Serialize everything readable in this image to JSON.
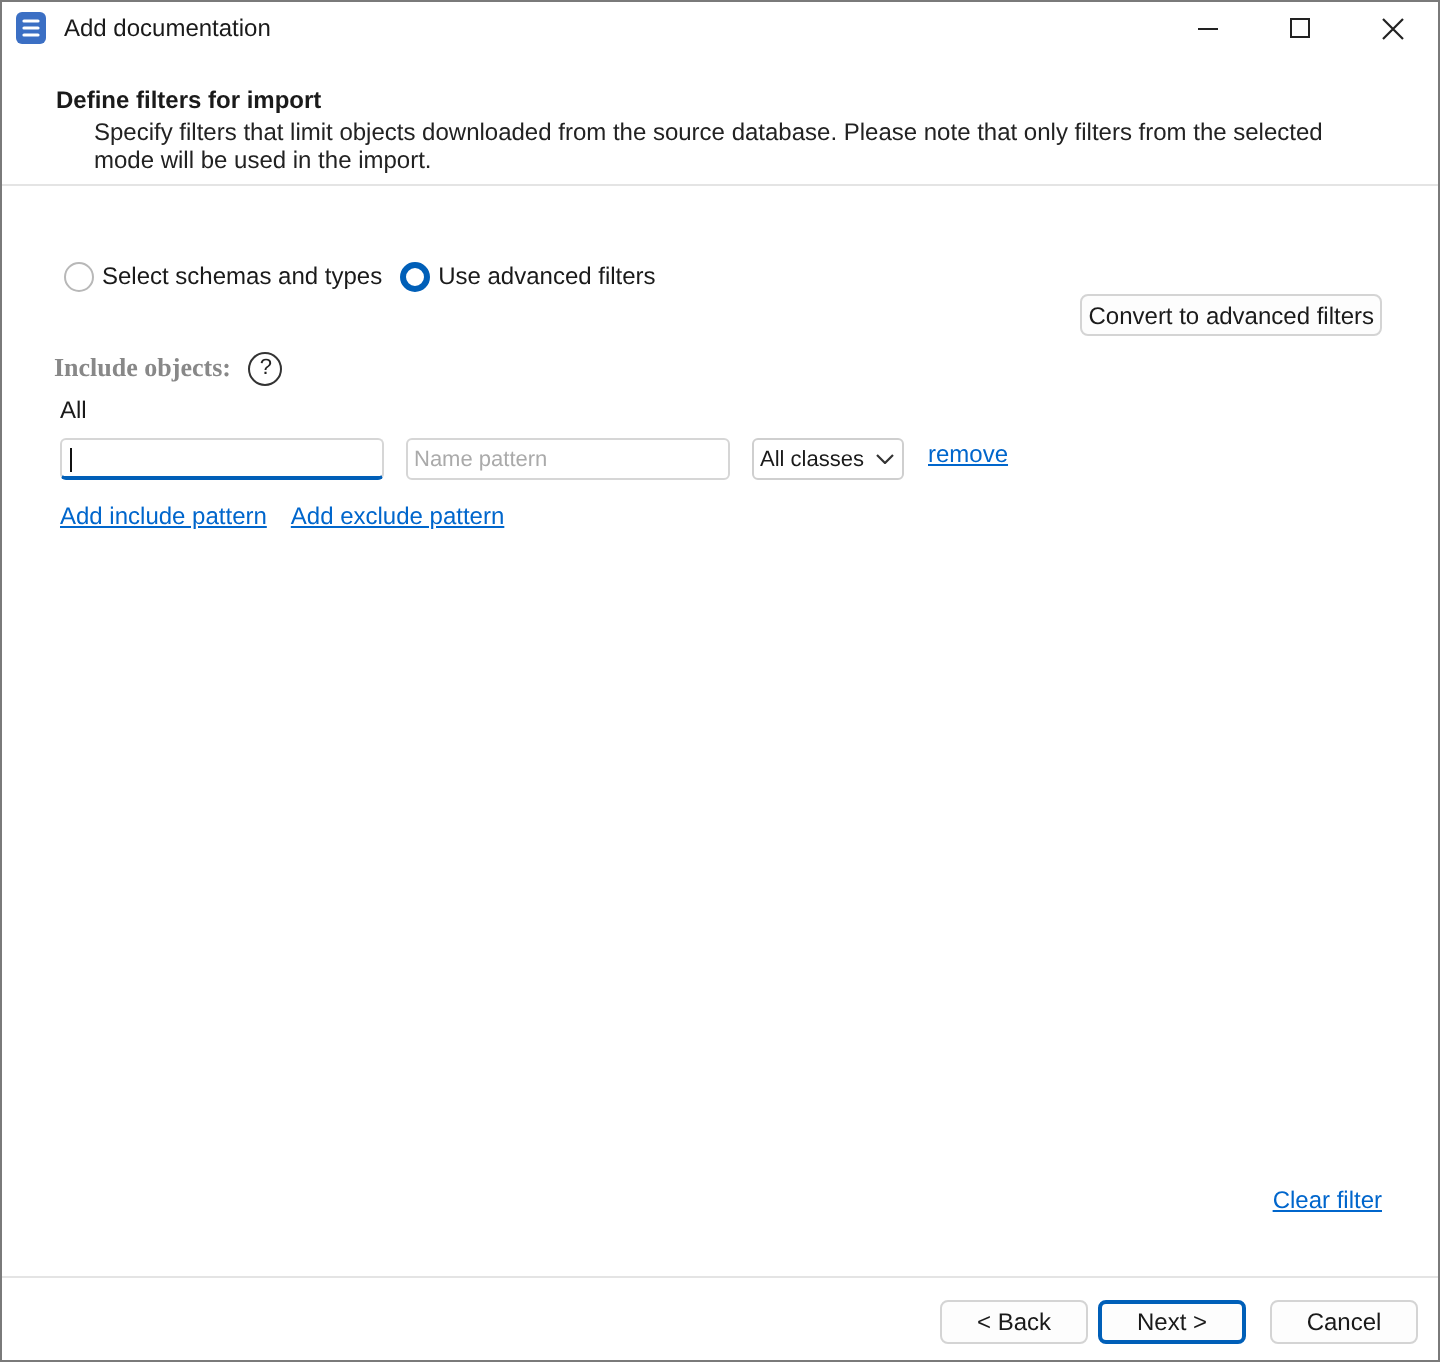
{
  "window": {
    "title": "Add documentation"
  },
  "header": {
    "title": "Define filters for import",
    "description": "Specify filters that limit objects downloaded from the source database. Please note that only filters from the selected mode will be used in the import."
  },
  "mode_options": [
    {
      "label": "Select schemas and types",
      "selected": false
    },
    {
      "label": "Use advanced filters",
      "selected": true
    }
  ],
  "convert_button": {
    "label": "Convert to advanced filters"
  },
  "include_objects": {
    "label": "Include objects:",
    "help_button": "?",
    "scope": "All",
    "patterns": [
      {
        "schema_field": {
          "focused": true
        },
        "name_field": {
          "placeholder": "Name pattern"
        },
        "class_dropdown": {
          "value": "All classes"
        },
        "remove_link": "remove"
      }
    ],
    "links": [
      "Add include pattern",
      "Add exclude pattern"
    ]
  },
  "clear_filter_link": "Clear filter",
  "buttons": [
    {
      "label": "< Back",
      "default": false
    },
    {
      "label": "Next >",
      "default": true
    },
    {
      "label": "Cancel",
      "default": false
    }
  ]
}
